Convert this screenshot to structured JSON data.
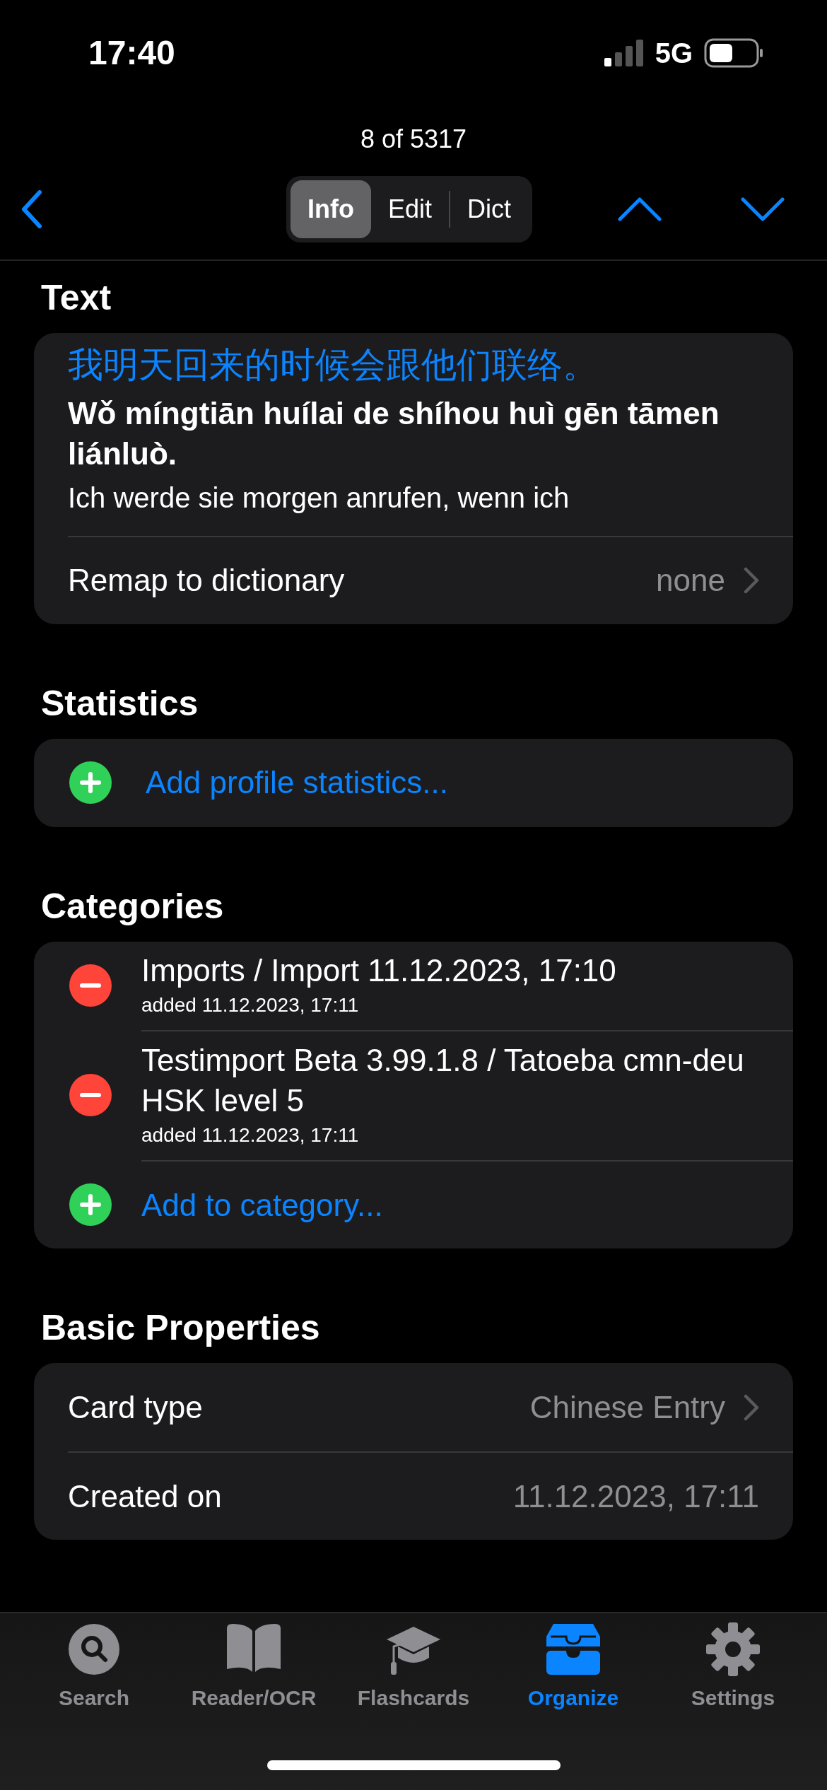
{
  "status_bar": {
    "time": "17:40",
    "network": "5G"
  },
  "nav": {
    "counter": "8 of 5317",
    "segments": [
      {
        "label": "Info",
        "selected": true
      },
      {
        "label": "Edit",
        "selected": false
      },
      {
        "label": "Dict",
        "selected": false
      }
    ]
  },
  "text_section": {
    "title": "Text",
    "chinese": "我明天回来的时候会跟他们联络。",
    "pinyin": "Wǒ míngtiān huílai de shíhou huì gēn tāmen liánluò.",
    "translation": "Ich werde sie morgen anrufen, wenn ich",
    "remap": {
      "label": "Remap to dictionary",
      "value": "none"
    }
  },
  "statistics": {
    "title": "Statistics",
    "add_label": "Add profile statistics..."
  },
  "categories": {
    "title": "Categories",
    "items": [
      {
        "name": "Imports / Import 11.12.2023, 17:10",
        "added": "added 11.12.2023, 17:11"
      },
      {
        "name": "Testimport Beta 3.99.1.8 / Tatoeba cmn-deu HSK level 5",
        "added": "added 11.12.2023, 17:11"
      }
    ],
    "add_label": "Add to category..."
  },
  "basic_properties": {
    "title": "Basic Properties",
    "rows": [
      {
        "label": "Card type",
        "value": "Chinese Entry",
        "kind": "link"
      },
      {
        "label": "Created on",
        "value": "11.12.2023, 17:11",
        "kind": "plain"
      }
    ]
  },
  "tab_bar": {
    "items": [
      {
        "label": "Search",
        "selected": false
      },
      {
        "label": "Reader/OCR",
        "selected": false
      },
      {
        "label": "Flashcards",
        "selected": false
      },
      {
        "label": "Organize",
        "selected": true
      },
      {
        "label": "Settings",
        "selected": false
      }
    ]
  }
}
